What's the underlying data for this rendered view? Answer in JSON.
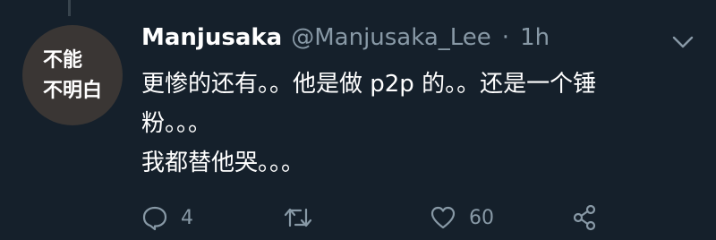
{
  "avatar": {
    "line1": "不能",
    "line2": "不明白"
  },
  "tweet": {
    "display_name": "Manjusaka",
    "handle": "@Manjusaka_Lee",
    "separator": "·",
    "time": "1h",
    "body_line1": "更惨的还有。。他是做 p2p 的。。还是一个锤",
    "body_line2": "粉。。。",
    "body_line3": "我都替他哭。。。"
  },
  "actions": {
    "reply_count": "4",
    "retweet_count": "",
    "like_count": "60"
  },
  "colors": {
    "background": "#15202b",
    "secondary_text": "#8899a6",
    "primary_text": "#ffffff"
  },
  "icons": {
    "reply": "reply-icon",
    "retweet": "retweet-icon",
    "like": "heart-icon",
    "share": "share-icon",
    "menu": "chevron-down-icon"
  }
}
